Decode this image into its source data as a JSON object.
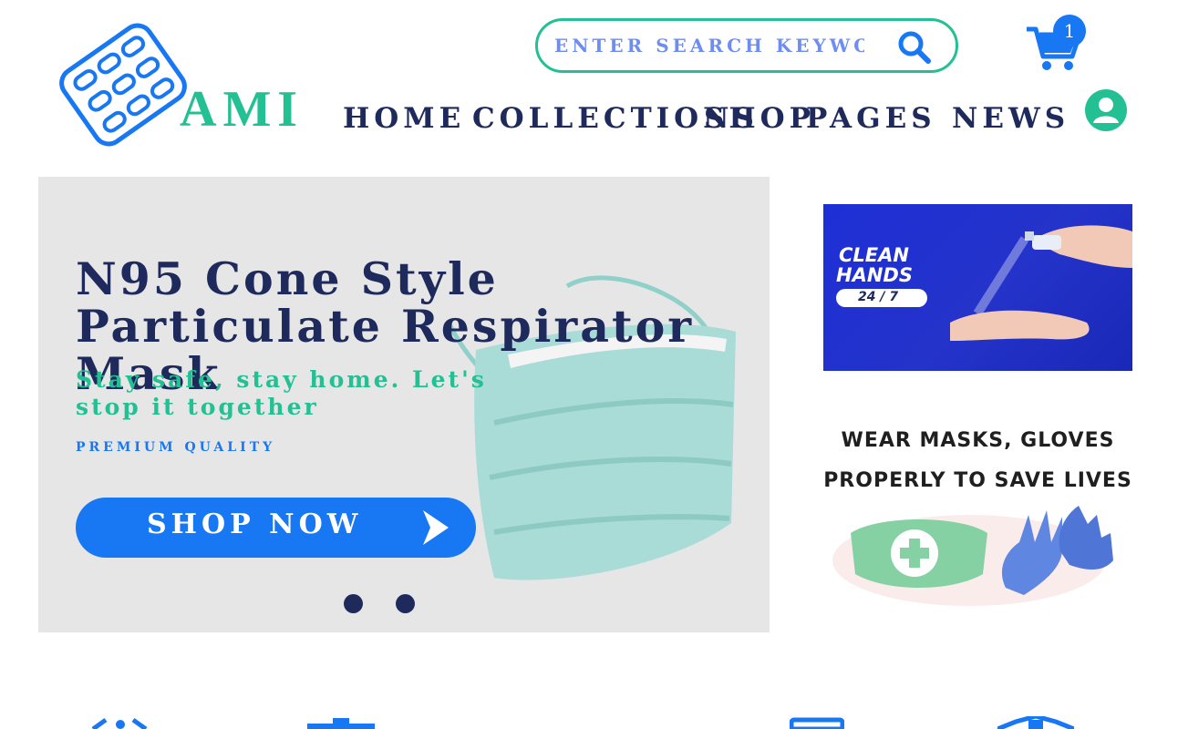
{
  "brand": {
    "name": "AMI"
  },
  "search": {
    "placeholder": "ENTER SEARCH KEYWORD"
  },
  "cart": {
    "count": "1"
  },
  "nav": {
    "items": [
      {
        "label": "HOME"
      },
      {
        "label": "COLLECTIONS"
      },
      {
        "label": "SHOP"
      },
      {
        "label": "PAGES"
      },
      {
        "label": "NEWS"
      }
    ]
  },
  "hero": {
    "title": "N95 Cone Style Particulate Respirator Mask",
    "subtitle": "Stay safe, stay home. Let's stop it together",
    "tagline": "PREMIUM QUALITY",
    "button_label": "SHOP NOW",
    "slide_count": 2
  },
  "banner_clean": {
    "line1": "CLEAN",
    "line2": "HANDS",
    "badge": "24 / 7"
  },
  "banner_masks": {
    "line1": "WEAR MASKS, GLOVES",
    "line2": "PROPERLY TO SAVE LIVES"
  },
  "colors": {
    "primary": "#1877f2",
    "accent": "#23c093",
    "navy": "#1f2a5c",
    "hero_bg": "#e6e6e6"
  },
  "icons": {
    "logo": "pill-blister-icon",
    "search": "search-icon",
    "cart": "shopping-cart-icon",
    "user": "user-circle-icon",
    "button_arrow": "chevron-right-icon"
  }
}
